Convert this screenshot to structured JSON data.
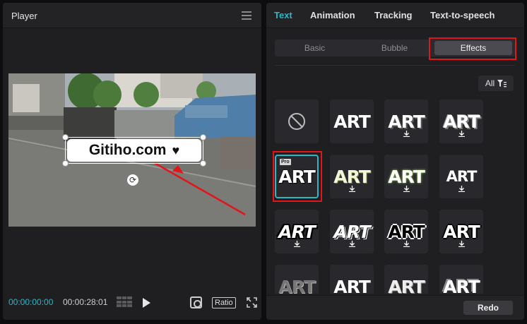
{
  "player": {
    "title": "Player",
    "caption_text": "Gitiho.com",
    "time_current": "00:00:00:00",
    "time_total": "00:00:28:01",
    "ratio_label": "Ratio"
  },
  "panel": {
    "tabs": [
      "Text",
      "Animation",
      "Tracking",
      "Text-to-speech"
    ],
    "subtabs": [
      "Basic",
      "Bubble",
      "Effects"
    ],
    "filter_label": "All",
    "pro_label": "Pro",
    "art_label": "ART",
    "redo_label": "Redo"
  },
  "colors": {
    "accent": "#29b8c8",
    "highlight": "#e3141a"
  },
  "icons": [
    "menu-icon",
    "heart-icon",
    "rotate-icon",
    "grid-icon",
    "play-icon",
    "crop-icon",
    "fullscreen-icon",
    "filter-icon",
    "none-icon",
    "download-icon"
  ]
}
